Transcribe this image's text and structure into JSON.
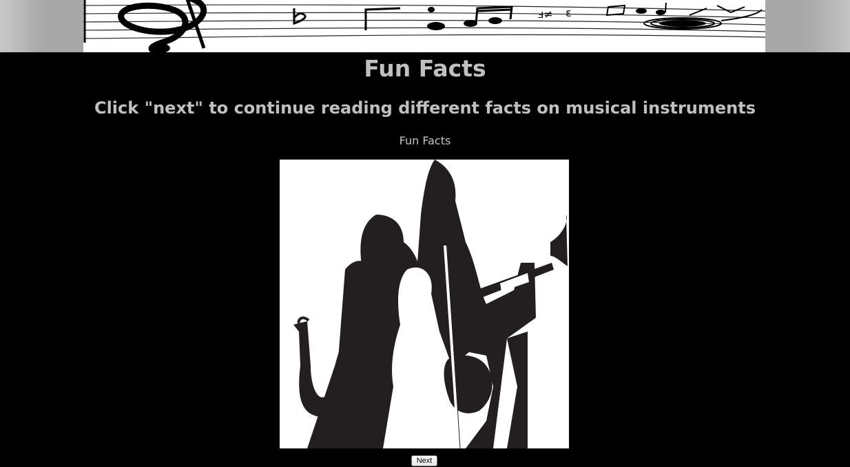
{
  "header": {
    "banner_icon": "music-staff-banner"
  },
  "main": {
    "title": "Fun Facts",
    "subtitle": "Click \"next\" to continue reading different facts on musical instruments",
    "caption": "Fun Facts",
    "image_icon": "musicians-silhouette-image",
    "next_label": "Next"
  },
  "colors": {
    "page_background": "#000000",
    "heading_text": "#c0c0c0",
    "side_band": "#a9a9a9"
  }
}
